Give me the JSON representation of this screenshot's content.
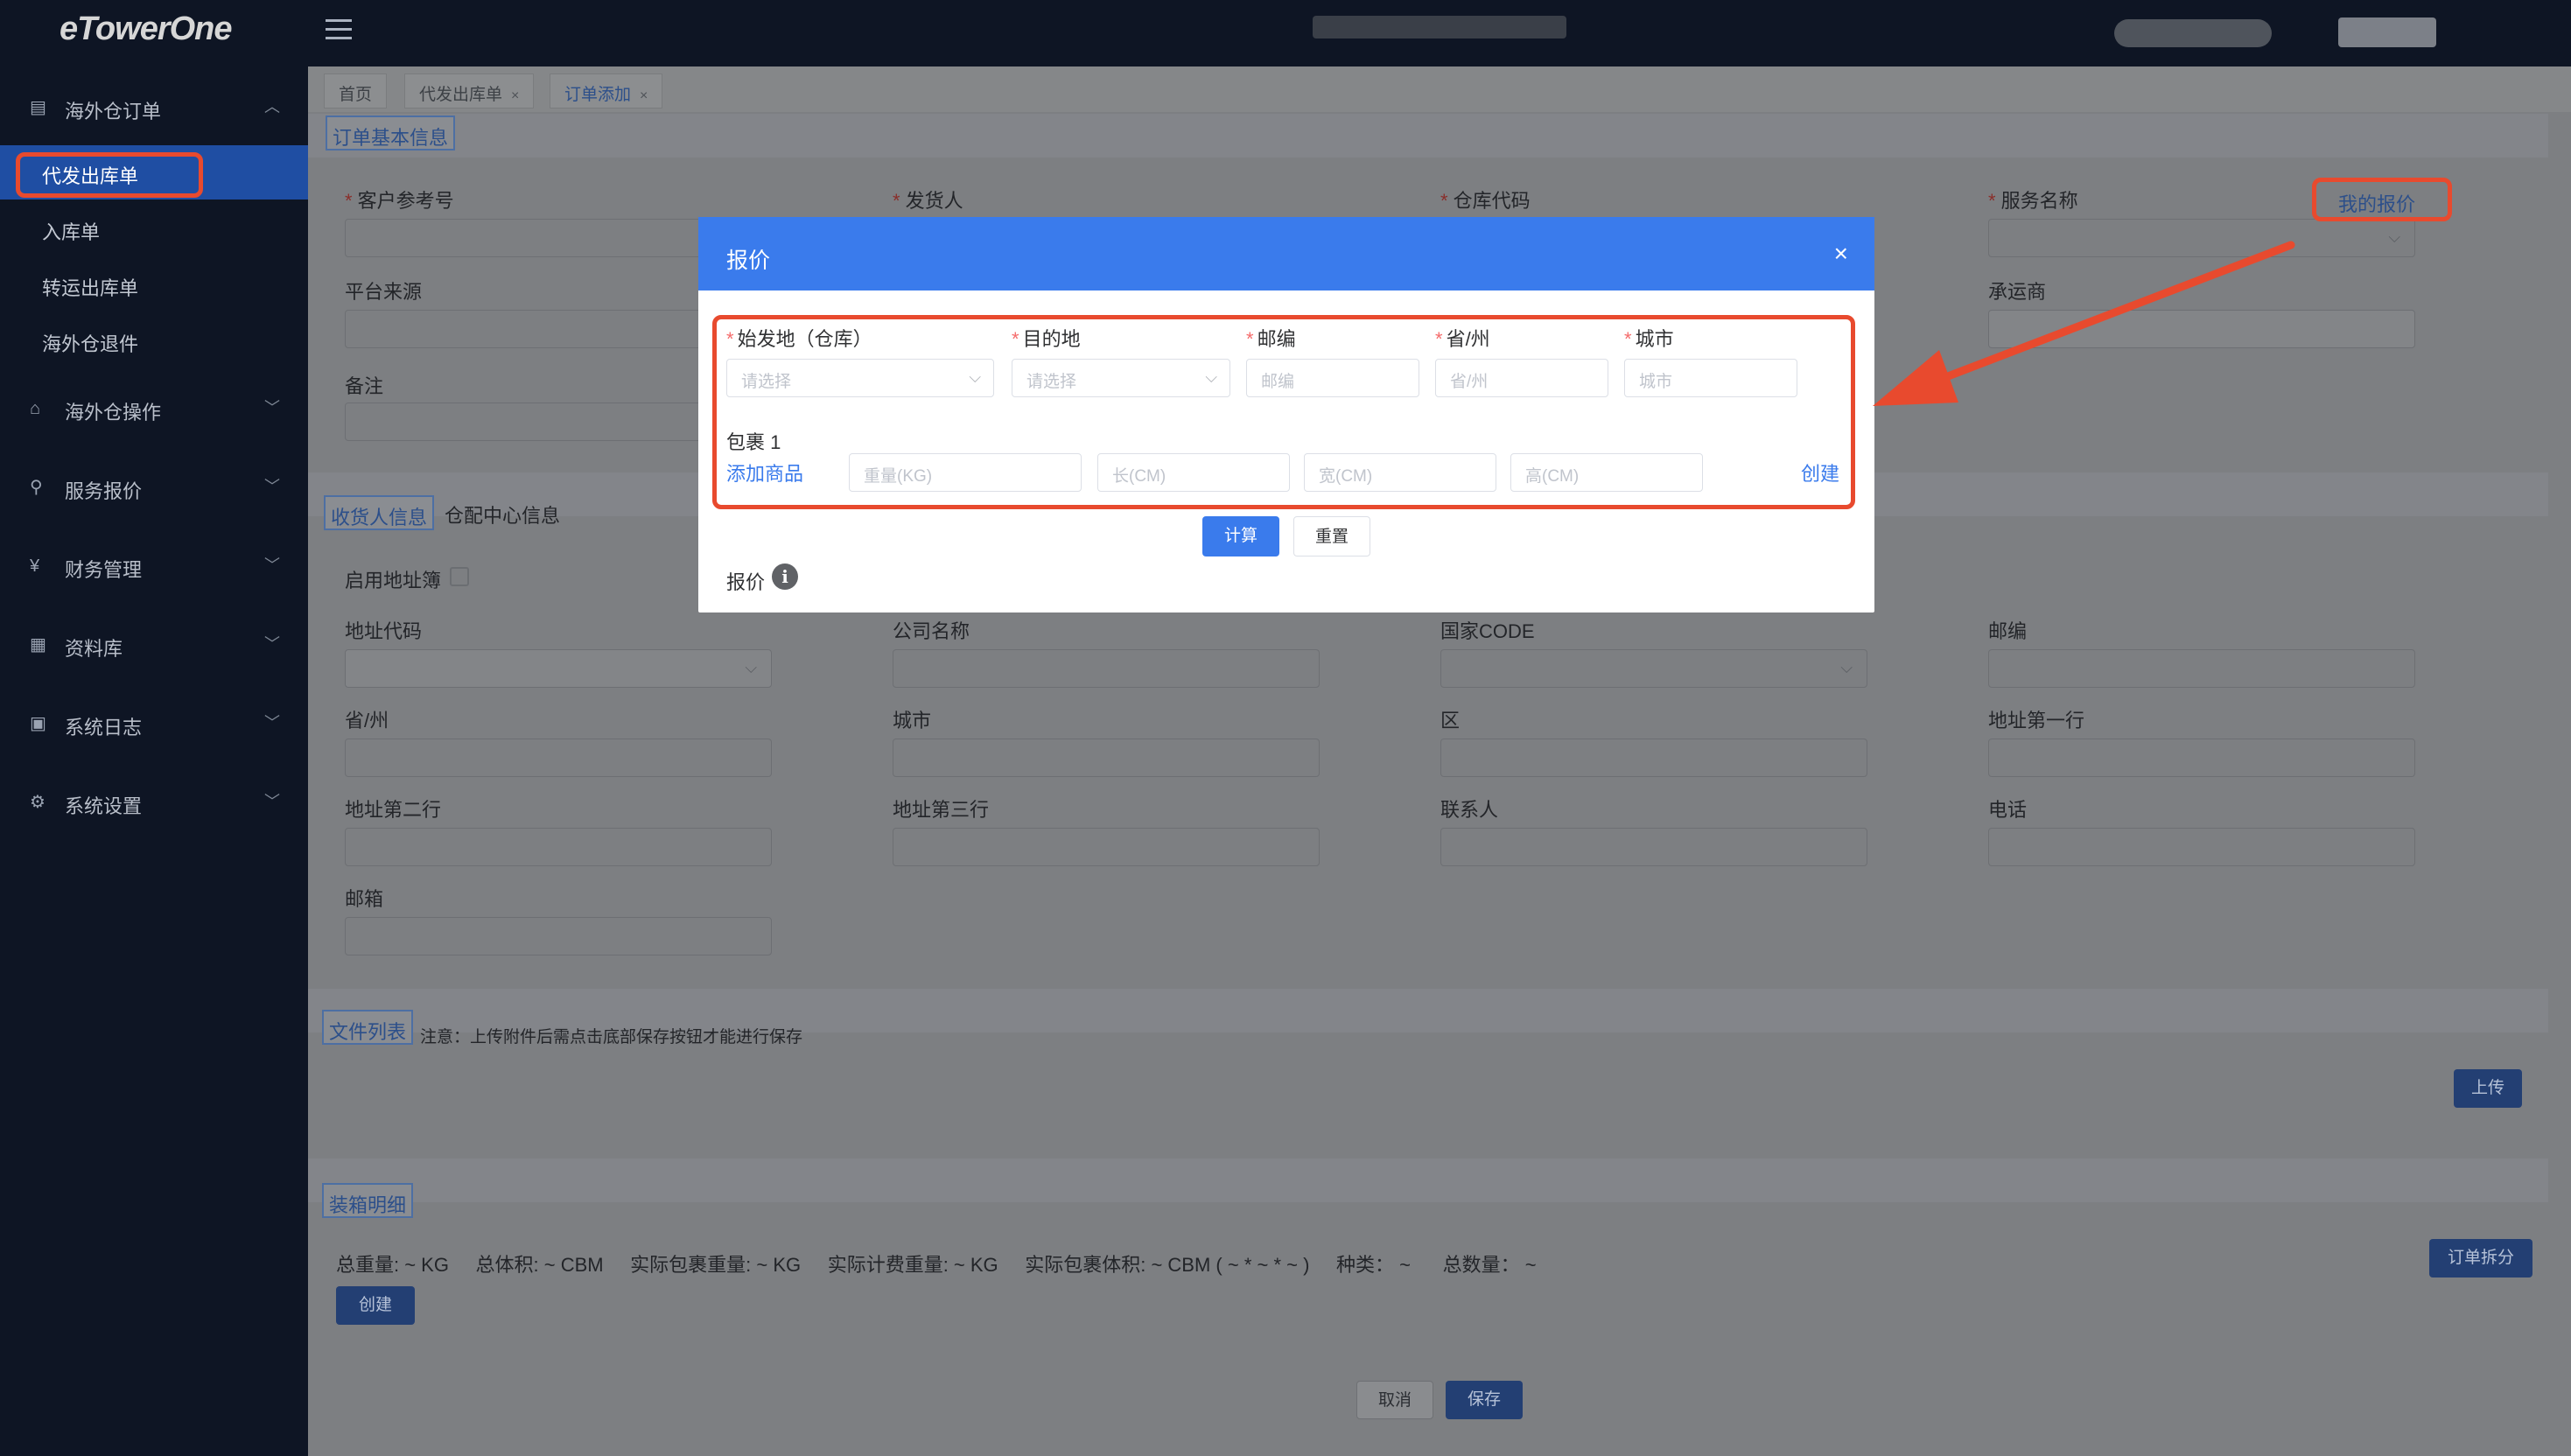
{
  "app": {
    "logo": "eTowerOne"
  },
  "colors": {
    "sidebar_bg": "#0e1524",
    "modal_header": "#3a7bec",
    "annotation_red": "#e84a2e",
    "primary": "#3a7bec"
  },
  "sidebar": {
    "groups": [
      {
        "label": "海外仓订单",
        "icon": "order-icon",
        "expanded": true
      },
      {
        "label": "海外仓操作",
        "icon": "warehouse-icon"
      },
      {
        "label": "服务报价",
        "icon": "share-icon"
      },
      {
        "label": "财务管理",
        "icon": "currency-icon"
      },
      {
        "label": "资料库",
        "icon": "grid-icon"
      },
      {
        "label": "系统日志",
        "icon": "calendar-icon"
      },
      {
        "label": "系统设置",
        "icon": "gear-icon"
      }
    ],
    "sub_items": [
      {
        "label": "代发出库单",
        "active": true
      },
      {
        "label": "入库单"
      },
      {
        "label": "转运出库单"
      },
      {
        "label": "海外仓退件"
      }
    ]
  },
  "tabs": [
    {
      "label": "首页"
    },
    {
      "label": "代发出库单",
      "close": "×"
    },
    {
      "label": "订单添加",
      "close": "×",
      "active": true
    }
  ],
  "basic_info": {
    "title": "订单基本信息",
    "fields": {
      "customer_ref": "客户参考号",
      "shipper": "发货人",
      "warehouse_code": "仓库代码",
      "service_name": "服务名称",
      "platform_source": "平台来源",
      "carrier": "承运商",
      "remark": "备注"
    },
    "my_quote_link": "我的报价"
  },
  "receiver": {
    "tab_receiver": "收货人信息",
    "tab_distribution": "仓配中心信息",
    "use_address_book": "启用地址簿",
    "fields": {
      "address_code": "地址代码",
      "company_name": "公司名称",
      "country_code": "国家CODE",
      "postcode": "邮编",
      "province": "省/州",
      "city": "城市",
      "district": "区",
      "address1": "地址第一行",
      "address2": "地址第二行",
      "address3": "地址第三行",
      "contact": "联系人",
      "phone": "电话",
      "email": "邮箱"
    }
  },
  "files": {
    "title": "文件列表",
    "note": "注意：上传附件后需点击底部保存按钮才能进行保存",
    "upload_button": "上传"
  },
  "packing": {
    "title": "装箱明细",
    "summary": "总重量: ~ KG     总体积: ~ CBM     实际包裹重量: ~ KG     实际计费重量: ~ KG     实际包裹体积: ~ CBM ( ~ * ~ * ~ )     种类： ~      总数量： ~",
    "create_button": "创建",
    "split_button": "订单拆分"
  },
  "footer": {
    "cancel": "取消",
    "save": "保存"
  },
  "modal": {
    "title": "报价",
    "close": "×",
    "origin_label": "始发地（仓库）",
    "origin_placeholder": "请选择",
    "destination_label": "目的地",
    "destination_placeholder": "请选择",
    "postcode_label": "邮编",
    "postcode_placeholder": "邮编",
    "province_label": "省/州",
    "province_placeholder": "省/州",
    "city_label": "城市",
    "city_placeholder": "城市",
    "package_label": "包裹 1",
    "add_product": "添加商品",
    "weight_placeholder": "重量(KG)",
    "length_placeholder": "长(CM)",
    "width_placeholder": "宽(CM)",
    "height_placeholder": "高(CM)",
    "create_link": "创建",
    "calc_button": "计算",
    "reset_button": "重置",
    "quote_label": "报价",
    "info_icon": "i"
  }
}
